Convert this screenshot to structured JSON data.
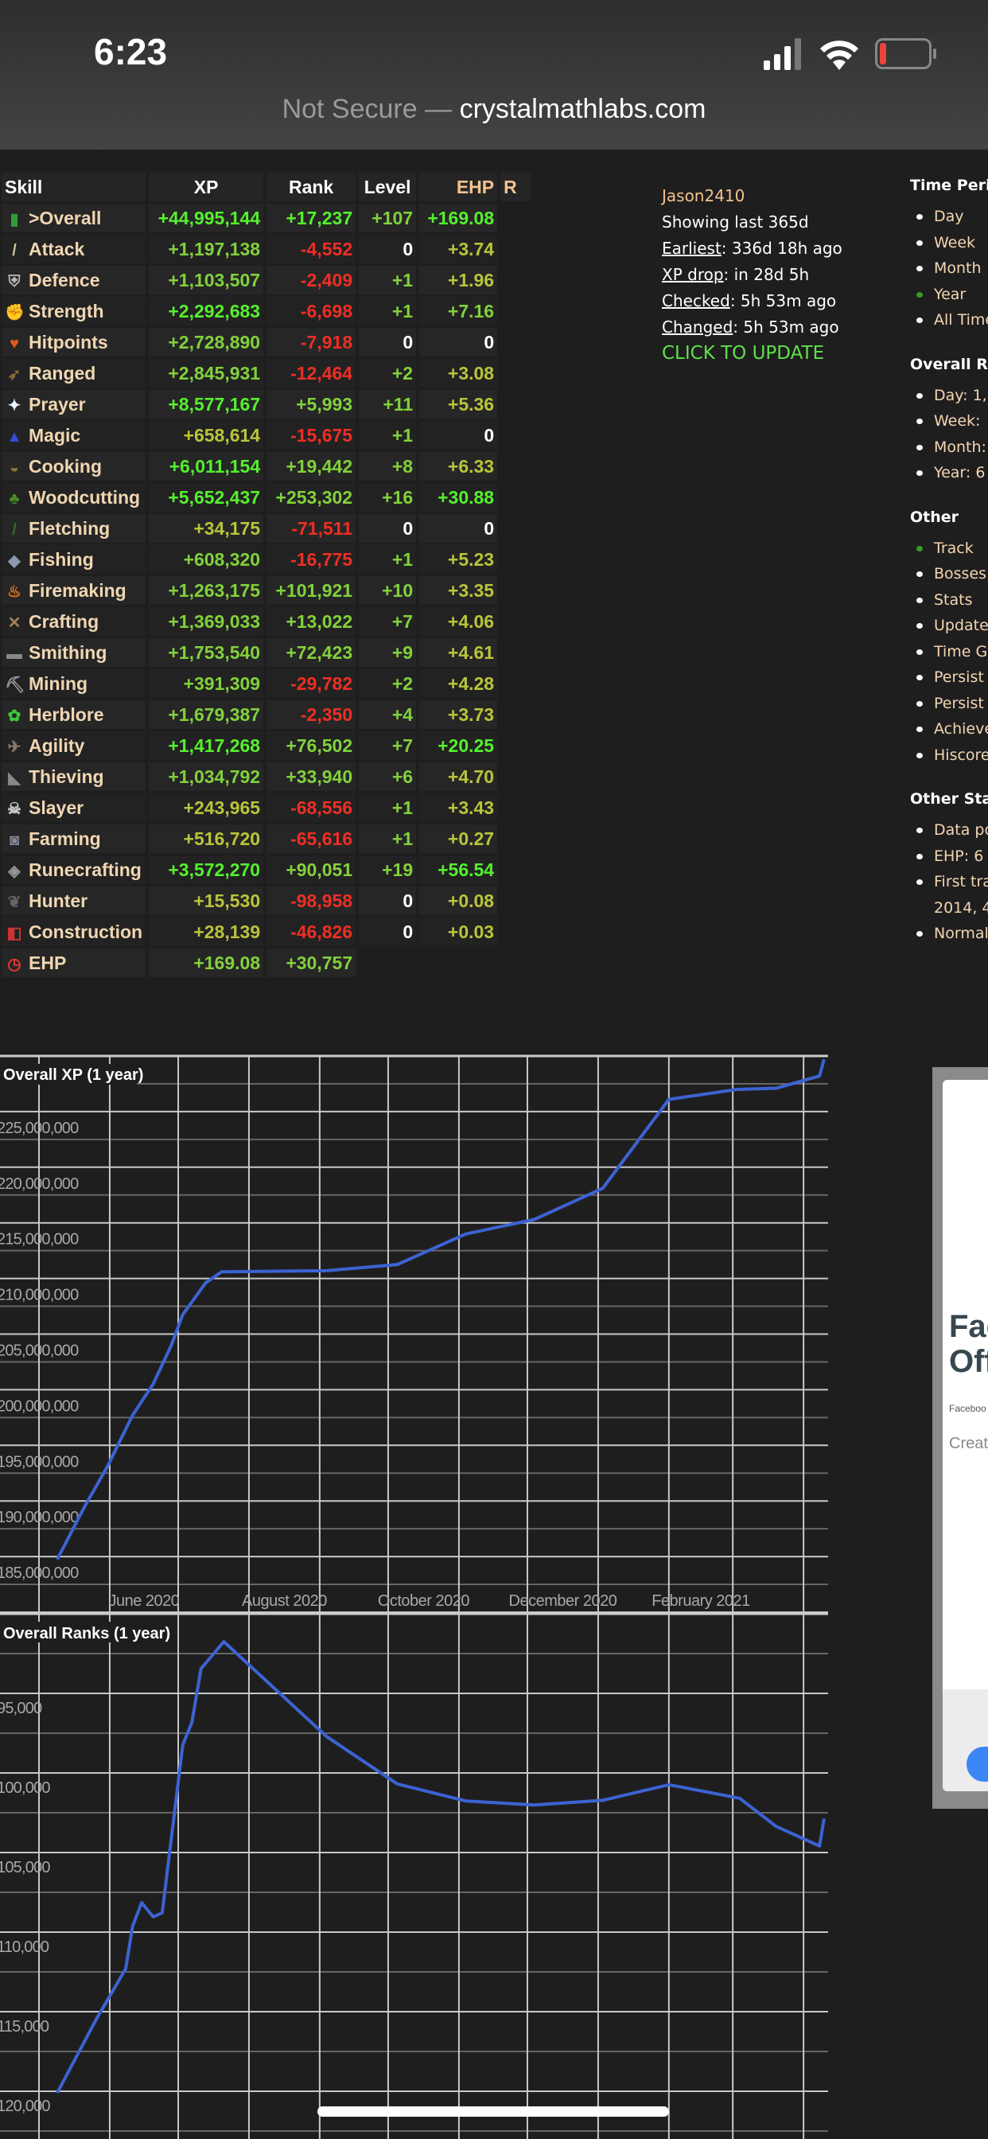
{
  "status_bar": {
    "time": "6:23",
    "battery_color": "#e8453c"
  },
  "browser": {
    "security": "Not Secure",
    "separator": " — ",
    "domain": "crystalmathlabs.com"
  },
  "table": {
    "headers": {
      "skill": "Skill",
      "xp": "XP",
      "rank": "Rank",
      "level": "Level",
      "ehp": "EHP",
      "r": "R"
    },
    "tone_colors": {
      "b": "#55f02e",
      "m": "#82d13c",
      "y": "#bac43a",
      "r": "#ef2e24",
      "w": "#ffffff"
    },
    "rows": [
      {
        "icon": "overall-icon",
        "skill": ">Overall",
        "xp": "+44,995,144",
        "xp_t": "b",
        "rank": "+17,237",
        "rank_t": "b",
        "level": "+107",
        "level_t": "m",
        "ehp": "+169.08",
        "ehp_t": "b"
      },
      {
        "icon": "attack-icon",
        "skill": "Attack",
        "xp": "+1,197,138",
        "xp_t": "m",
        "rank": "-4,552",
        "rank_t": "r",
        "level": "0",
        "level_t": "w",
        "ehp": "+3.74",
        "ehp_t": "y"
      },
      {
        "icon": "defence-icon",
        "skill": "Defence",
        "xp": "+1,103,507",
        "xp_t": "m",
        "rank": "-2,409",
        "rank_t": "r",
        "level": "+1",
        "level_t": "m",
        "ehp": "+1.96",
        "ehp_t": "y"
      },
      {
        "icon": "strength-icon",
        "skill": "Strength",
        "xp": "+2,292,683",
        "xp_t": "b",
        "rank": "-6,698",
        "rank_t": "r",
        "level": "+1",
        "level_t": "m",
        "ehp": "+7.16",
        "ehp_t": "m"
      },
      {
        "icon": "hitpoints-icon",
        "skill": "Hitpoints",
        "xp": "+2,728,890",
        "xp_t": "m",
        "rank": "-7,918",
        "rank_t": "r",
        "level": "0",
        "level_t": "w",
        "ehp": "0",
        "ehp_t": "w"
      },
      {
        "icon": "ranged-icon",
        "skill": "Ranged",
        "xp": "+2,845,931",
        "xp_t": "m",
        "rank": "-12,464",
        "rank_t": "r",
        "level": "+2",
        "level_t": "m",
        "ehp": "+3.08",
        "ehp_t": "y"
      },
      {
        "icon": "prayer-icon",
        "skill": "Prayer",
        "xp": "+8,577,167",
        "xp_t": "b",
        "rank": "+5,993",
        "rank_t": "m",
        "level": "+11",
        "level_t": "m",
        "ehp": "+5.36",
        "ehp_t": "y"
      },
      {
        "icon": "magic-icon",
        "skill": "Magic",
        "xp": "+658,614",
        "xp_t": "y",
        "rank": "-15,675",
        "rank_t": "r",
        "level": "+1",
        "level_t": "m",
        "ehp": "0",
        "ehp_t": "w"
      },
      {
        "icon": "cooking-icon",
        "skill": "Cooking",
        "xp": "+6,011,154",
        "xp_t": "b",
        "rank": "+19,442",
        "rank_t": "m",
        "level": "+8",
        "level_t": "m",
        "ehp": "+6.33",
        "ehp_t": "y"
      },
      {
        "icon": "woodcutting-icon",
        "skill": "Woodcutting",
        "xp": "+5,652,437",
        "xp_t": "b",
        "rank": "+253,302",
        "rank_t": "m",
        "level": "+16",
        "level_t": "m",
        "ehp": "+30.88",
        "ehp_t": "b"
      },
      {
        "icon": "fletching-icon",
        "skill": "Fletching",
        "xp": "+34,175",
        "xp_t": "y",
        "rank": "-71,511",
        "rank_t": "r",
        "level": "0",
        "level_t": "w",
        "ehp": "0",
        "ehp_t": "w"
      },
      {
        "icon": "fishing-icon",
        "skill": "Fishing",
        "xp": "+608,320",
        "xp_t": "m",
        "rank": "-16,775",
        "rank_t": "r",
        "level": "+1",
        "level_t": "m",
        "ehp": "+5.23",
        "ehp_t": "y"
      },
      {
        "icon": "firemaking-icon",
        "skill": "Firemaking",
        "xp": "+1,263,175",
        "xp_t": "m",
        "rank": "+101,921",
        "rank_t": "m",
        "level": "+10",
        "level_t": "m",
        "ehp": "+3.35",
        "ehp_t": "y"
      },
      {
        "icon": "crafting-icon",
        "skill": "Crafting",
        "xp": "+1,369,033",
        "xp_t": "m",
        "rank": "+13,022",
        "rank_t": "m",
        "level": "+7",
        "level_t": "m",
        "ehp": "+4.06",
        "ehp_t": "y"
      },
      {
        "icon": "smithing-icon",
        "skill": "Smithing",
        "xp": "+1,753,540",
        "xp_t": "m",
        "rank": "+72,423",
        "rank_t": "m",
        "level": "+9",
        "level_t": "m",
        "ehp": "+4.61",
        "ehp_t": "y"
      },
      {
        "icon": "mining-icon",
        "skill": "Mining",
        "xp": "+391,309",
        "xp_t": "m",
        "rank": "-29,782",
        "rank_t": "r",
        "level": "+2",
        "level_t": "m",
        "ehp": "+4.28",
        "ehp_t": "y"
      },
      {
        "icon": "herblore-icon",
        "skill": "Herblore",
        "xp": "+1,679,387",
        "xp_t": "m",
        "rank": "-2,350",
        "rank_t": "r",
        "level": "+4",
        "level_t": "m",
        "ehp": "+3.73",
        "ehp_t": "y"
      },
      {
        "icon": "agility-icon",
        "skill": "Agility",
        "xp": "+1,417,268",
        "xp_t": "b",
        "rank": "+76,502",
        "rank_t": "m",
        "level": "+7",
        "level_t": "m",
        "ehp": "+20.25",
        "ehp_t": "b"
      },
      {
        "icon": "thieving-icon",
        "skill": "Thieving",
        "xp": "+1,034,792",
        "xp_t": "m",
        "rank": "+33,940",
        "rank_t": "m",
        "level": "+6",
        "level_t": "m",
        "ehp": "+4.70",
        "ehp_t": "y"
      },
      {
        "icon": "slayer-icon",
        "skill": "Slayer",
        "xp": "+243,965",
        "xp_t": "y",
        "rank": "-68,556",
        "rank_t": "r",
        "level": "+1",
        "level_t": "m",
        "ehp": "+3.43",
        "ehp_t": "y"
      },
      {
        "icon": "farming-icon",
        "skill": "Farming",
        "xp": "+516,720",
        "xp_t": "y",
        "rank": "-65,616",
        "rank_t": "r",
        "level": "+1",
        "level_t": "m",
        "ehp": "+0.27",
        "ehp_t": "y"
      },
      {
        "icon": "runecrafting-icon",
        "skill": "Runecrafting",
        "xp": "+3,572,270",
        "xp_t": "b",
        "rank": "+90,051",
        "rank_t": "m",
        "level": "+19",
        "level_t": "m",
        "ehp": "+56.54",
        "ehp_t": "b"
      },
      {
        "icon": "hunter-icon",
        "skill": "Hunter",
        "xp": "+15,530",
        "xp_t": "y",
        "rank": "-98,958",
        "rank_t": "r",
        "level": "0",
        "level_t": "w",
        "ehp": "+0.08",
        "ehp_t": "y"
      },
      {
        "icon": "construction-icon",
        "skill": "Construction",
        "xp": "+28,139",
        "xp_t": "y",
        "rank": "-46,826",
        "rank_t": "r",
        "level": "0",
        "level_t": "w",
        "ehp": "+0.03",
        "ehp_t": "y"
      },
      {
        "icon": "ehp-clock-icon",
        "skill": "EHP",
        "xp": "+169.08",
        "xp_t": "m",
        "rank": "+30,757",
        "rank_t": "m",
        "level": "",
        "level_t": "w",
        "ehp": "",
        "ehp_t": "w"
      }
    ]
  },
  "player": {
    "name": "Jason2410",
    "showing": "Showing last 365d",
    "earliest_label": "Earliest",
    "earliest_value": ": 336d 18h ago",
    "xpdrop_label": "XP drop",
    "xpdrop_value": ": in 28d 5h",
    "checked_label": "Checked",
    "checked_value": ": 5h 53m ago",
    "changed_label": "Changed",
    "changed_value": ": 5h 53m ago",
    "update_link": "CLICK TO UPDATE"
  },
  "sidebar": {
    "sections": [
      {
        "title": "Time Peri",
        "items": [
          {
            "label": "Day"
          },
          {
            "label": "Week"
          },
          {
            "label": "Month"
          },
          {
            "label": "Year",
            "active": true
          },
          {
            "label": "All Time"
          }
        ]
      },
      {
        "title": "Overall Re",
        "items": [
          {
            "label": "Day: 1,"
          },
          {
            "label": "Week:"
          },
          {
            "label": "Month:"
          },
          {
            "label": "Year: 6"
          }
        ]
      },
      {
        "title": "Other",
        "items": [
          {
            "label": "Track",
            "active": true
          },
          {
            "label": "Bosses"
          },
          {
            "label": "Stats"
          },
          {
            "label": "Update"
          },
          {
            "label": "Time G"
          },
          {
            "label": "Persist"
          },
          {
            "label": "Persist"
          },
          {
            "label": "Achieve"
          },
          {
            "label": "Hiscore"
          }
        ]
      },
      {
        "title": "Other Sta",
        "items": [
          {
            "label": "Data po"
          },
          {
            "label": "EHP: 6"
          },
          {
            "label": "First tra"
          },
          {
            "label": "2014, 4",
            "continuation": true
          },
          {
            "label": "Normal"
          }
        ]
      }
    ]
  },
  "ad": {
    "title_line1": "Fac",
    "title_line2": "Off",
    "source": "Faceboo",
    "cta": "Creat",
    "button_color": "#3b86f5"
  },
  "chart_data": [
    {
      "type": "line",
      "title": "Overall XP (1 year)",
      "xlabel": "",
      "ylabel": "",
      "ylim": [
        180000000,
        230000000
      ],
      "yticks": [
        "185,000,000",
        "190,000,000",
        "195,000,000",
        "200,000,000",
        "205,000,000",
        "210,000,000",
        "215,000,000",
        "220,000,000",
        "225,000,000"
      ],
      "yticks_values": [
        185000000,
        190000000,
        195000000,
        200000000,
        205000000,
        210000000,
        215000000,
        220000000,
        225000000
      ],
      "xticks": [
        "June 2020",
        "August 2020",
        "October 2020",
        "December 2020",
        "February 2021"
      ],
      "xlim": [
        "2020-05-01",
        "2021-04-12"
      ],
      "grid": true,
      "line_color": "#3c63d3",
      "series": [
        {
          "x": [
            "2020-05-09",
            "2020-05-21",
            "2020-05-31",
            "2020-06-11",
            "2020-06-20",
            "2020-06-28",
            "2020-07-03",
            "2020-07-13",
            "2020-07-20",
            "2020-09-04",
            "2020-10-05",
            "2020-11-04",
            "2020-12-04",
            "2021-01-03",
            "2021-02-01",
            "2021-03-03",
            "2021-03-20",
            "2021-04-08",
            "2021-04-10"
          ],
          "y": [
            184750000,
            189500000,
            193100000,
            197700000,
            200500000,
            204000000,
            206750000,
            209600000,
            210600000,
            210700000,
            211250000,
            214000000,
            215300000,
            218100000,
            226100000,
            227000000,
            227100000,
            228200000,
            229700000
          ]
        }
      ]
    },
    {
      "type": "line",
      "title": "Overall Ranks (1 year)",
      "xlabel": "",
      "ylabel": "",
      "y_inverted": true,
      "ylim": [
        90000,
        123000
      ],
      "yticks": [
        "95,000",
        "100,000",
        "105,000",
        "110,000",
        "115,000",
        "120,000"
      ],
      "yticks_values": [
        95000,
        100000,
        105000,
        110000,
        115000,
        120000
      ],
      "xlim": [
        "2020-05-01",
        "2021-04-12"
      ],
      "grid": true,
      "line_color": "#3c63d3",
      "series": [
        {
          "x": [
            "2020-05-09",
            "2020-05-26",
            "2020-06-08",
            "2020-06-11",
            "2020-06-15",
            "2020-06-20",
            "2020-06-24",
            "2020-07-03",
            "2020-07-07",
            "2020-07-11",
            "2020-07-16",
            "2020-07-21",
            "2020-09-04",
            "2020-10-05",
            "2020-11-04",
            "2020-12-04",
            "2021-01-03",
            "2021-02-01",
            "2021-03-04",
            "2021-03-20",
            "2021-04-08",
            "2021-04-10"
          ],
          "y": [
            120100,
            115500,
            112300,
            109640,
            108150,
            109040,
            108790,
            98240,
            96820,
            93450,
            92600,
            91750,
            97710,
            100690,
            101760,
            102010,
            101720,
            100740,
            101590,
            103360,
            104590,
            102870
          ]
        }
      ]
    }
  ]
}
